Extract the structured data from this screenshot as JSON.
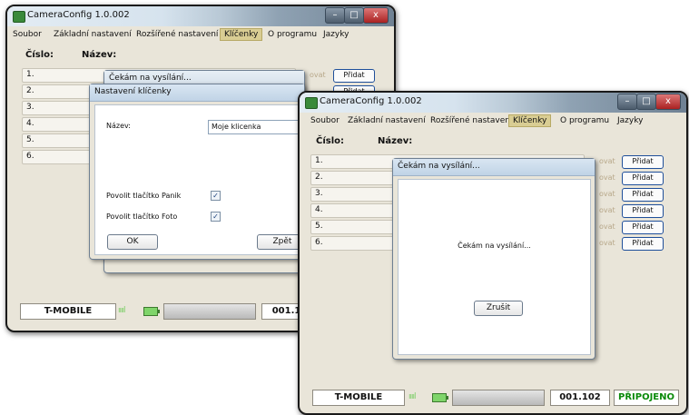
{
  "app": {
    "title": "CameraConfig 1.0.002"
  },
  "window_controls": {
    "minimize": "–",
    "maximize": "□",
    "close": "x"
  },
  "menu": [
    "Soubor",
    "Základní nastavení",
    "Rozšířené nastavení",
    "Klíčenky",
    "O programu",
    "Jazyky"
  ],
  "active_menu": "Klíčenky",
  "table": {
    "col_number": "Číslo:",
    "col_name": "Název:",
    "rows": [
      "1.",
      "2.",
      "3.",
      "4.",
      "5.",
      "6."
    ],
    "partial_action": "ovat",
    "add_label": "Přidat"
  },
  "waiting_dialog": {
    "title": "Čekám na vysílání...",
    "message": "Čekám na vysílání...",
    "cancel_label": "Zrušit"
  },
  "keychain_dialog": {
    "title": "Nastavení klíčenky",
    "name_label": "Název:",
    "name_value": "Moje klicenka",
    "panic_label": "Povolit tlačítko Panik",
    "photo_label": "Povolit tlačítko Foto",
    "panic_checked": true,
    "photo_checked": true,
    "ok_label": "OK",
    "back_label": "Zpět"
  },
  "status": {
    "operator": "T-MOBILE",
    "signal": "ııııl",
    "code": "001.102",
    "code_left_visible": "001.10",
    "connection": "PŘIPOJENO",
    "connection_color": "#0a8a0a"
  }
}
